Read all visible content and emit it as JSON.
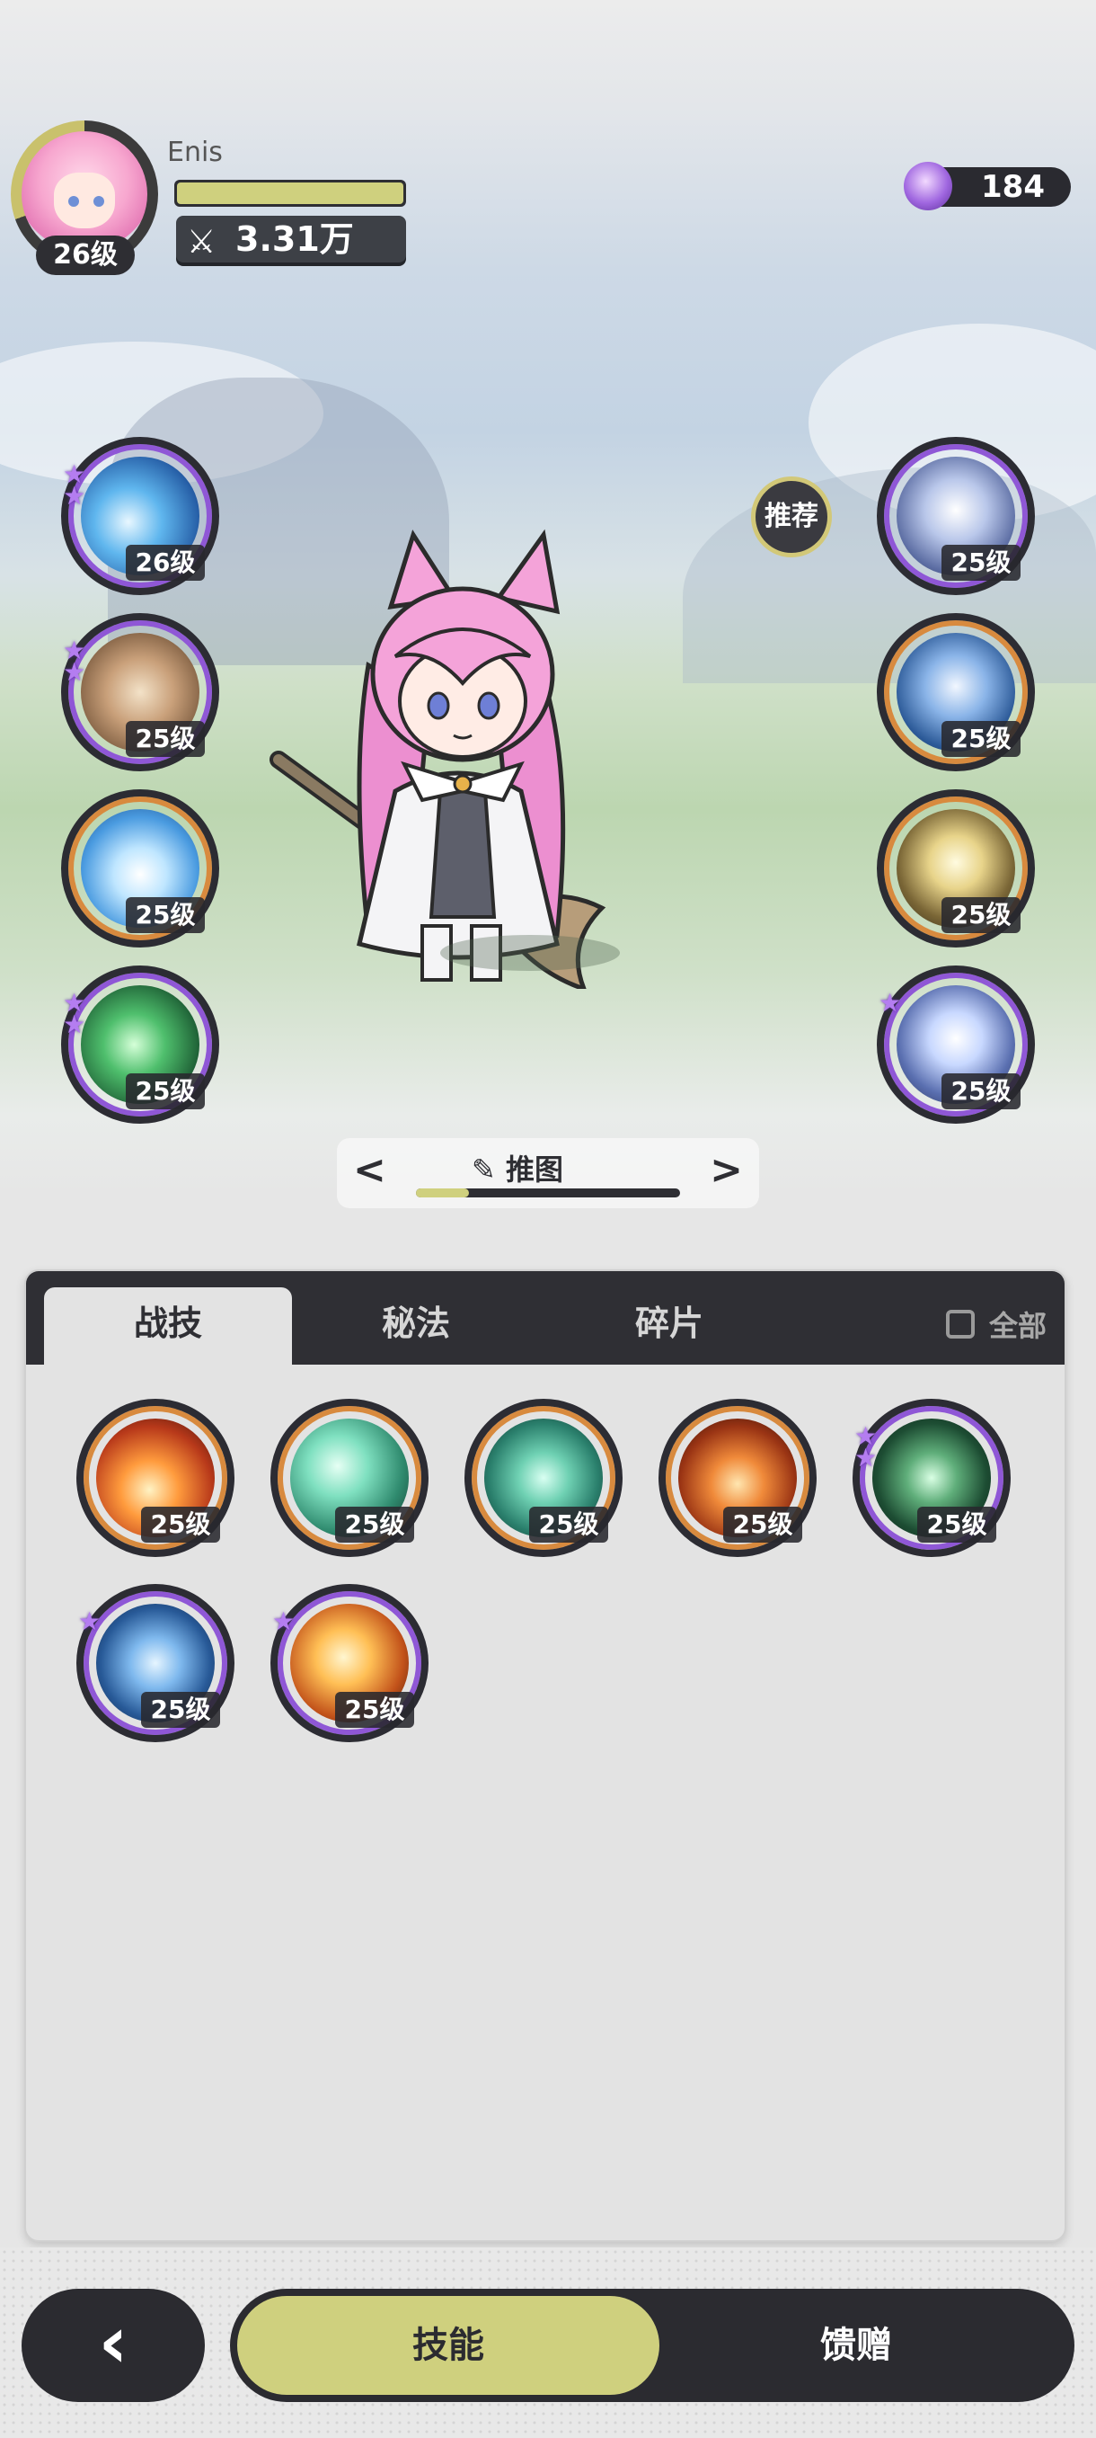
{
  "header": {
    "player_name": "Enis",
    "player_level": "26级",
    "power_icon": "crossed-swords-icon",
    "power_value": "3.31万",
    "gem_icon": "character-token-icon",
    "gem_count": "184"
  },
  "left_orbs": [
    {
      "level": "26级",
      "icon": "water-splash-icon",
      "rarity": "purple",
      "stars": 2
    },
    {
      "level": "25级",
      "icon": "cards-icon",
      "rarity": "purple",
      "stars": 2
    },
    {
      "level": "25级",
      "icon": "ice-burst-icon",
      "rarity": "gold",
      "stars": 0
    },
    {
      "level": "25级",
      "icon": "heal-plus-icon",
      "rarity": "purple",
      "stars": 2
    }
  ],
  "right_orbs": [
    {
      "level": "25级",
      "icon": "orb-shield-icon",
      "rarity": "purple",
      "stars": 0
    },
    {
      "level": "25级",
      "icon": "ice-crystal-icon",
      "rarity": "gold",
      "stars": 0
    },
    {
      "level": "25级",
      "icon": "light-pillar-icon",
      "rarity": "gold",
      "stars": 0
    },
    {
      "level": "25级",
      "icon": "star-crystal-icon",
      "rarity": "purple",
      "stars": 1
    }
  ],
  "recommend_label": "推荐",
  "preset": {
    "name": "推图",
    "prev_icon": "chevron-left-icon",
    "next_icon": "chevron-right-icon",
    "edit_icon": "pencil-icon"
  },
  "tabs": [
    {
      "label": "战技",
      "active": true
    },
    {
      "label": "秘法",
      "active": false
    },
    {
      "label": "碎片",
      "active": false
    }
  ],
  "check_all_label": "全部",
  "skills": [
    {
      "level": "25级",
      "icon": "fire-icon",
      "rarity": "gold",
      "stars": 0
    },
    {
      "level": "25级",
      "icon": "wind-slash-icon",
      "rarity": "gold",
      "stars": 0
    },
    {
      "level": "25级",
      "icon": "vortex-icon",
      "rarity": "gold",
      "stars": 0
    },
    {
      "level": "25级",
      "icon": "fire-swirl-icon",
      "rarity": "gold",
      "stars": 0
    },
    {
      "level": "25级",
      "icon": "thorn-vine-icon",
      "rarity": "purple",
      "stars": 2
    },
    {
      "level": "25级",
      "icon": "ice-shard-icon",
      "rarity": "purple",
      "stars": 1
    },
    {
      "level": "25级",
      "icon": "fire-orb-icon",
      "rarity": "purple",
      "stars": 1
    }
  ],
  "bottom_nav": {
    "back_icon": "chevron-left-icon",
    "tab_skills": "技能",
    "tab_gift": "馈赠"
  },
  "colors": {
    "accent": "#cfd07e",
    "dark": "#2e2e33",
    "purple_frame": "#8f57d6",
    "gold_frame": "#d88a3e"
  }
}
